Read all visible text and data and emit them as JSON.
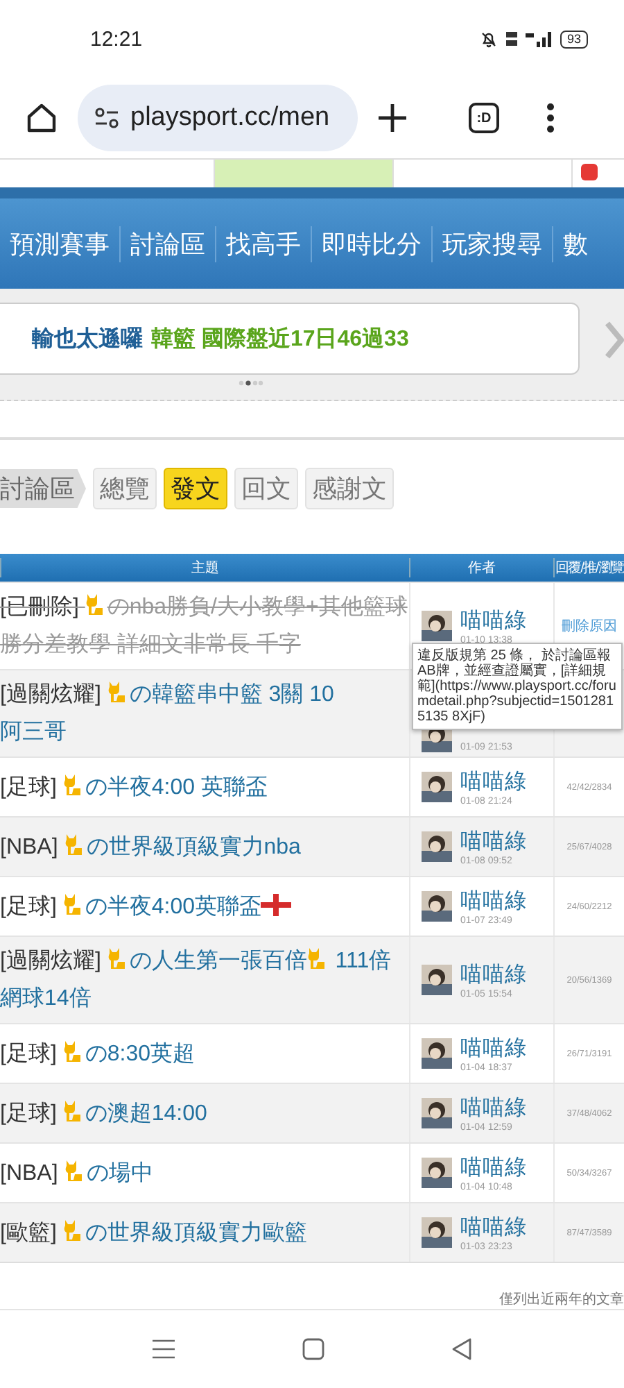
{
  "status_bar": {
    "time": "12:21",
    "battery": "93"
  },
  "browser": {
    "url": "playsport.cc/men",
    "tab_label": ":D"
  },
  "top_tabs": [
    {
      "selected": false
    },
    {
      "selected": true
    },
    {
      "selected": false
    },
    {
      "selected": false
    }
  ],
  "nav": {
    "items": [
      "預測賽事",
      "討論區",
      "找高手",
      "即時比分",
      "玩家搜尋",
      "數"
    ]
  },
  "banner": {
    "name": "輸也太遜囉",
    "info": "韓籃 國際盤近17日46過33"
  },
  "breadcrumb": {
    "section": "討論區",
    "tabs": [
      {
        "label": "總覽",
        "selected": false
      },
      {
        "label": "發文",
        "selected": true
      },
      {
        "label": "回文",
        "selected": false
      },
      {
        "label": "感謝文",
        "selected": false
      }
    ]
  },
  "table": {
    "columns": [
      "主題",
      "作者",
      "回覆/推/瀏覽"
    ],
    "rows": [
      {
        "category": "[已刪除]",
        "deleted": true,
        "parts": [
          {
            "kind": "cat"
          },
          {
            "kind": "text",
            "text": "のnba勝負/大小教學+其他籃球勝分差教學 詳細文非常長 千字"
          }
        ],
        "author": "喵喵綠",
        "date": "01-10 13:38",
        "delete_reason": "刪除原因"
      },
      {
        "category": "[過關炫耀]",
        "deleted": false,
        "parts": [
          {
            "kind": "cat"
          },
          {
            "kind": "text",
            "text": "の韓籃串中籃 3關 10"
          },
          {
            "kind": "break"
          },
          {
            "kind": "text",
            "text": "阿三哥"
          }
        ],
        "date": "01-09 21:53"
      },
      {
        "category": "[足球]",
        "deleted": false,
        "parts": [
          {
            "kind": "cat"
          },
          {
            "kind": "text",
            "text": "の半夜4:00 英聯盃"
          }
        ],
        "author": "喵喵綠",
        "date": "01-08 21:24",
        "stats": "42/42/2834"
      },
      {
        "category": "[NBA]",
        "deleted": false,
        "parts": [
          {
            "kind": "cat"
          },
          {
            "kind": "text",
            "text": "の世界級頂級實力nba"
          }
        ],
        "author": "喵喵綠",
        "date": "01-08 09:52",
        "stats": "25/67/4028"
      },
      {
        "category": "[足球]",
        "deleted": false,
        "parts": [
          {
            "kind": "cat"
          },
          {
            "kind": "text",
            "text": "の半夜4:00英聯盃"
          },
          {
            "kind": "flag"
          }
        ],
        "author": "喵喵綠",
        "date": "01-07 23:49",
        "stats": "24/60/2212"
      },
      {
        "category": "[過關炫耀]",
        "deleted": false,
        "parts": [
          {
            "kind": "cat"
          },
          {
            "kind": "text",
            "text": "の人生第一張百倍"
          },
          {
            "kind": "cat"
          },
          {
            "kind": "text",
            "text": " 111倍網球14倍"
          }
        ],
        "author": "喵喵綠",
        "date": "01-05 15:54",
        "stats": "20/56/1369"
      },
      {
        "category": "[足球]",
        "deleted": false,
        "parts": [
          {
            "kind": "cat"
          },
          {
            "kind": "text",
            "text": "の8:30英超"
          }
        ],
        "author": "喵喵綠",
        "date": "01-04 18:37",
        "stats": "26/71/3191"
      },
      {
        "category": "[足球]",
        "deleted": false,
        "parts": [
          {
            "kind": "cat"
          },
          {
            "kind": "text",
            "text": "の澳超14:00"
          }
        ],
        "author": "喵喵綠",
        "date": "01-04 12:59",
        "stats": "37/48/4062"
      },
      {
        "category": "[NBA]",
        "deleted": false,
        "parts": [
          {
            "kind": "cat"
          },
          {
            "kind": "text",
            "text": "の場中"
          }
        ],
        "author": "喵喵綠",
        "date": "01-04 10:48",
        "stats": "50/34/3267"
      },
      {
        "category": "[歐籃]",
        "deleted": false,
        "parts": [
          {
            "kind": "cat"
          },
          {
            "kind": "text",
            "text": "の世界級頂級實力歐籃"
          }
        ],
        "author": "喵喵綠",
        "date": "01-03 23:23",
        "stats": "87/47/3589"
      }
    ]
  },
  "tooltip": "違反版規第 25 條， 於討論區報AB牌，並經查證屬實，[詳細規範](https://www.playsport.cc/forumdetail.php?subjectid=15012815135 8XjF)",
  "footer_note": "僅列出近兩年的文章"
}
